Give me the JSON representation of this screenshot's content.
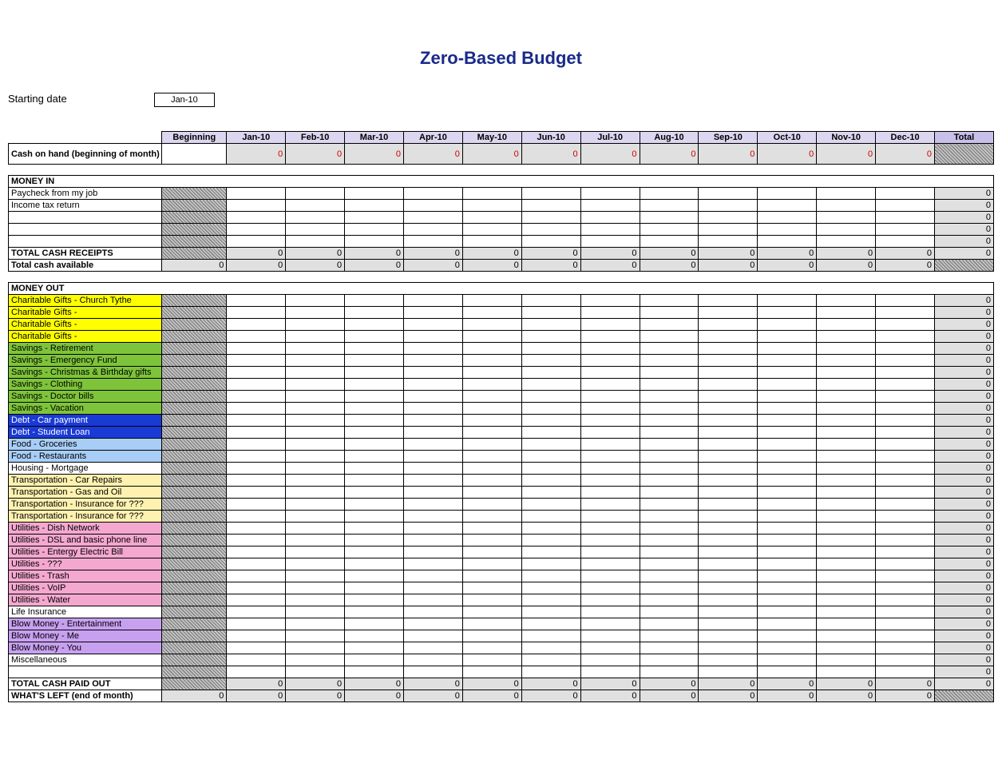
{
  "title": "Zero-Based Budget",
  "startingDateLabel": "Starting date",
  "startingDateValue": "Jan-10",
  "columns": {
    "label": "",
    "beginning": "Beginning",
    "months": [
      "Jan-10",
      "Feb-10",
      "Mar-10",
      "Apr-10",
      "May-10",
      "Jun-10",
      "Jul-10",
      "Aug-10",
      "Sep-10",
      "Oct-10",
      "Nov-10",
      "Dec-10"
    ],
    "total": "Total"
  },
  "cashOnHandLabel": "Cash on hand (beginning of month)",
  "cashOnHandValues": {
    "months": [
      0,
      0,
      0,
      0,
      0,
      0,
      0,
      0,
      0,
      0,
      0,
      0
    ]
  },
  "moneyInHeader": "MONEY IN",
  "incomeRows": [
    {
      "label": "Paycheck from my job",
      "total": 0
    },
    {
      "label": "Income tax return",
      "total": 0
    },
    {
      "label": "",
      "total": 0
    },
    {
      "label": "",
      "total": 0
    },
    {
      "label": "",
      "total": 0
    }
  ],
  "totalCashReceiptsLabel": "TOTAL CASH RECEIPTS",
  "totalCashReceipts": {
    "months": [
      0,
      0,
      0,
      0,
      0,
      0,
      0,
      0,
      0,
      0,
      0,
      0
    ],
    "total": 0
  },
  "totalCashAvailableLabel": "Total cash available",
  "totalCashAvailable": {
    "beginning": 0,
    "months": [
      0,
      0,
      0,
      0,
      0,
      0,
      0,
      0,
      0,
      0,
      0,
      0
    ]
  },
  "moneyOutHeader": "MONEY OUT",
  "expenseRows": [
    {
      "label": "Charitable Gifts - Church Tythe",
      "color": "#ffff00",
      "total": 0
    },
    {
      "label": "Charitable Gifts -",
      "color": "#ffff00",
      "total": 0
    },
    {
      "label": "Charitable Gifts -",
      "color": "#ffff00",
      "total": 0
    },
    {
      "label": "Charitable Gifts -",
      "color": "#ffff00",
      "total": 0
    },
    {
      "label": "Savings - Retirement",
      "color": "#7ec43a",
      "total": 0
    },
    {
      "label": "Savings - Emergency Fund",
      "color": "#7ec43a",
      "total": 0
    },
    {
      "label": "Savings - Christmas & Birthday gifts",
      "color": "#7ec43a",
      "total": 0
    },
    {
      "label": "Savings - Clothing",
      "color": "#7ec43a",
      "total": 0
    },
    {
      "label": "Savings - Doctor bills",
      "color": "#7ec43a",
      "total": 0
    },
    {
      "label": "Savings - Vacation",
      "color": "#7ec43a",
      "total": 0
    },
    {
      "label": "Debt - Car payment",
      "color": "#1a3ad6",
      "txt": "#fff",
      "total": 0
    },
    {
      "label": "Debt - Student Loan",
      "color": "#1a3ad6",
      "txt": "#fff",
      "total": 0
    },
    {
      "label": "Food - Groceries",
      "color": "#a8cef8",
      "total": 0
    },
    {
      "label": "Food - Restaurants",
      "color": "#a8cef8",
      "total": 0
    },
    {
      "label": "Housing - Mortgage",
      "color": "#ffffff",
      "total": 0
    },
    {
      "label": "Transportation - Car Repairs",
      "color": "#fff2b0",
      "total": 0
    },
    {
      "label": "Transportation - Gas and Oil",
      "color": "#fff2b0",
      "total": 0
    },
    {
      "label": "Transportation - Insurance for ???",
      "color": "#fff2b0",
      "total": 0
    },
    {
      "label": "Transportation - Insurance for ???",
      "color": "#fff2b0",
      "total": 0
    },
    {
      "label": "Utilities - Dish Network",
      "color": "#f4a8d0",
      "total": 0
    },
    {
      "label": "Utilities - DSL and basic phone line",
      "color": "#f4a8d0",
      "total": 0
    },
    {
      "label": "Utilities - Entergy Electric Bill",
      "color": "#f4a8d0",
      "total": 0
    },
    {
      "label": "Utilities - ???",
      "color": "#f4a8d0",
      "total": 0
    },
    {
      "label": "Utilities - Trash",
      "color": "#f4a8d0",
      "total": 0
    },
    {
      "label": "Utilities - VoIP",
      "color": "#f4a8d0",
      "total": 0
    },
    {
      "label": "Utilities - Water",
      "color": "#f4a8d0",
      "total": 0
    },
    {
      "label": "Life Insurance",
      "color": "#ffffff",
      "total": 0
    },
    {
      "label": "Blow Money - Entertainment",
      "color": "#c8a0f0",
      "total": 0
    },
    {
      "label": "Blow Money - Me",
      "color": "#c8a0f0",
      "total": 0
    },
    {
      "label": "Blow Money - You",
      "color": "#c8a0f0",
      "total": 0
    },
    {
      "label": "Miscellaneous",
      "color": "#ffffff",
      "total": 0
    },
    {
      "label": "",
      "color": "#ffffff",
      "total": 0
    }
  ],
  "totalCashPaidOutLabel": "TOTAL CASH PAID OUT",
  "totalCashPaidOut": {
    "months": [
      0,
      0,
      0,
      0,
      0,
      0,
      0,
      0,
      0,
      0,
      0,
      0
    ],
    "total": 0
  },
  "whatsLeftLabel": "WHAT'S LEFT (end of month)",
  "whatsLeft": {
    "beginning": 0,
    "months": [
      0,
      0,
      0,
      0,
      0,
      0,
      0,
      0,
      0,
      0,
      0,
      0
    ]
  }
}
